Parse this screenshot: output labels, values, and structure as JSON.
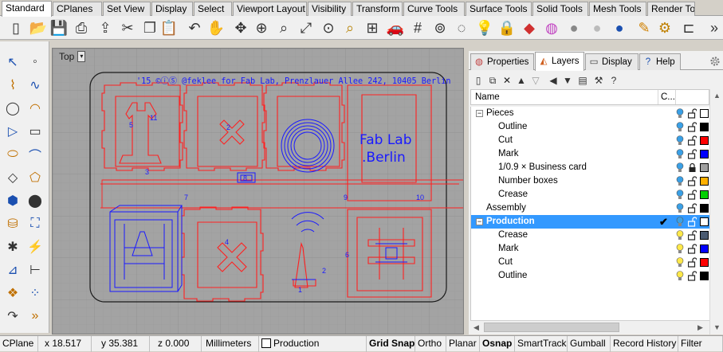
{
  "tabs": [
    "Standard",
    "CPlanes",
    "Set View",
    "Display",
    "Select",
    "Viewport Layout",
    "Visibility",
    "Transform",
    "Curve Tools",
    "Surface Tools",
    "Solid Tools",
    "Mesh Tools",
    "Render Tools"
  ],
  "viewport": {
    "title": "Top"
  },
  "drawing": {
    "header": "'15 ©ⓘⓈ @feklee for Fab Lab, Prenzlauer Allee 242, 10405 Berlin",
    "fablab_line1": "Fab Lab",
    "fablab_line2": ".Berlin",
    "numbers": {
      "n1": "1",
      "n2": "2",
      "n3": "3",
      "n4": "4",
      "n5": "5",
      "n6": "6",
      "n7": "7",
      "n8": "8",
      "n9": "9",
      "n10": "10",
      "n11": "11"
    }
  },
  "panel": {
    "tabs": [
      "Properties",
      "Layers",
      "Display",
      "Help"
    ],
    "columns": {
      "name": "Name",
      "color": "C..."
    }
  },
  "layers": [
    {
      "name": "Pieces",
      "indent": 0,
      "expander": "−",
      "selected": false,
      "current": false,
      "bulb": "#3aa0e6",
      "locked": false,
      "color": "#ffffff"
    },
    {
      "name": "Outline",
      "indent": 1,
      "selected": false,
      "current": false,
      "bulb": "#3aa0e6",
      "locked": false,
      "color": "#000000"
    },
    {
      "name": "Cut",
      "indent": 1,
      "selected": false,
      "current": false,
      "bulb": "#3aa0e6",
      "locked": false,
      "color": "#ff0000"
    },
    {
      "name": "Mark",
      "indent": 1,
      "selected": false,
      "current": false,
      "bulb": "#3aa0e6",
      "locked": false,
      "color": "#0000ff"
    },
    {
      "name": "1/0.9 × Business card",
      "indent": 1,
      "selected": false,
      "current": false,
      "bulb": "#3aa0e6",
      "locked": true,
      "color": "#a0a0a0"
    },
    {
      "name": "Number boxes",
      "indent": 1,
      "selected": false,
      "current": false,
      "bulb": "#3aa0e6",
      "locked": false,
      "color": "#ffb000"
    },
    {
      "name": "Crease",
      "indent": 1,
      "selected": false,
      "current": false,
      "bulb": "#3aa0e6",
      "locked": false,
      "color": "#00d000"
    },
    {
      "name": "Assembly",
      "indent": 0,
      "selected": false,
      "current": false,
      "bulb": "#3aa0e6",
      "locked": false,
      "color": "#000000"
    },
    {
      "name": "Production",
      "indent": 0,
      "expander": "−",
      "selected": true,
      "current": true,
      "bulb": "#3aa0e6",
      "locked": false,
      "color": "#ffffff"
    },
    {
      "name": "Crease",
      "indent": 1,
      "selected": false,
      "current": false,
      "bulb": "#ffe84a",
      "locked": false,
      "color": "#4a5a70"
    },
    {
      "name": "Mark",
      "indent": 1,
      "selected": false,
      "current": false,
      "bulb": "#ffe84a",
      "locked": false,
      "color": "#0000ff"
    },
    {
      "name": "Cut",
      "indent": 1,
      "selected": false,
      "current": false,
      "bulb": "#ffe84a",
      "locked": false,
      "color": "#ff0000"
    },
    {
      "name": "Outline",
      "indent": 1,
      "selected": false,
      "current": false,
      "bulb": "#ffe84a",
      "locked": false,
      "color": "#000000"
    }
  ],
  "status": {
    "cplane": "CPlane",
    "x": "x 18.517",
    "y": "y 35.381",
    "z": "z 0.000",
    "units": "Millimeters",
    "layer": "Production",
    "items": [
      "Grid Snap",
      "Ortho",
      "Planar",
      "Osnap",
      "SmartTrack",
      "Gumball",
      "Record History",
      "Filter"
    ],
    "bold_items": [
      "Grid Snap",
      "Osnap"
    ]
  },
  "colors": {
    "cut": "#ff2020",
    "mark": "#1a1aff",
    "selection": "#3399ff"
  },
  "toolbar_icons": [
    "new-icon",
    "open-icon",
    "save-icon",
    "print-icon",
    "import-icon",
    "cut-icon",
    "copy-icon",
    "paste-icon",
    "undo-icon",
    "pan-icon",
    "rotate-view-icon",
    "zoom-icon",
    "zoom-window-icon",
    "zoom-extents-icon",
    "zoom-selected-icon",
    "zoom-dynamic-icon",
    "four-viewports-icon",
    "car-icon",
    "grid-icon",
    "cplane-icon",
    "select-icon",
    "light-icon",
    "lock-icon",
    "render-mode-icon",
    "color-wheel-icon",
    "sphere-gray-icon",
    "sphere-white-icon",
    "sphere-blue-icon",
    "pencil-icon",
    "gear-icon",
    "options-icon",
    "more-icon"
  ]
}
